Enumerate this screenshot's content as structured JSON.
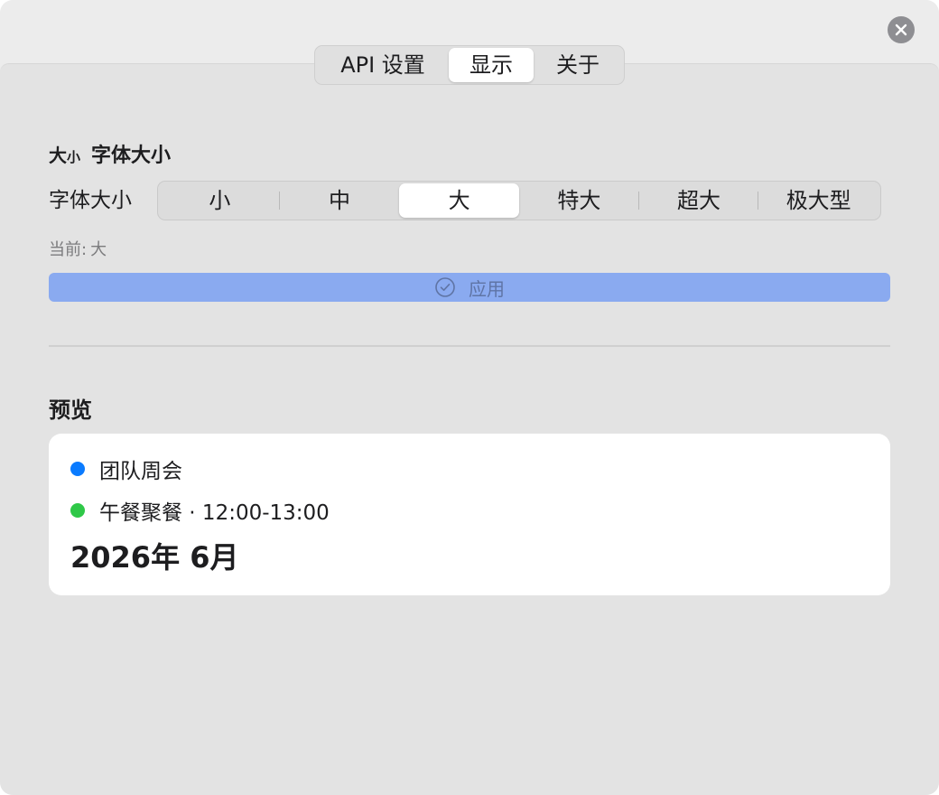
{
  "tabs": [
    {
      "label": "API 设置",
      "selected": false
    },
    {
      "label": "显示",
      "selected": true
    },
    {
      "label": "关于",
      "selected": false
    }
  ],
  "font_section": {
    "icon_big": "大",
    "icon_small": "小",
    "title": "字体大小",
    "label": "字体大小",
    "options": [
      "小",
      "中",
      "大",
      "特大",
      "超大",
      "极大型"
    ],
    "selected": "大",
    "current_prefix": "当前:",
    "current_value": "大",
    "apply_label": "应用"
  },
  "preview": {
    "title": "预览",
    "events": [
      {
        "text": "团队周会",
        "color": "#0a7bff"
      },
      {
        "text": "午餐聚餐 · 12:00-13:00",
        "color": "#2fc848"
      }
    ],
    "month": "2026年 6月"
  },
  "colors": {
    "accent_button": "#8aaaf0",
    "window_bg": "#ececec",
    "panel_bg": "#e3e3e3"
  },
  "icons": {
    "close": "close-icon",
    "apply": "checkmark-circle-icon"
  }
}
